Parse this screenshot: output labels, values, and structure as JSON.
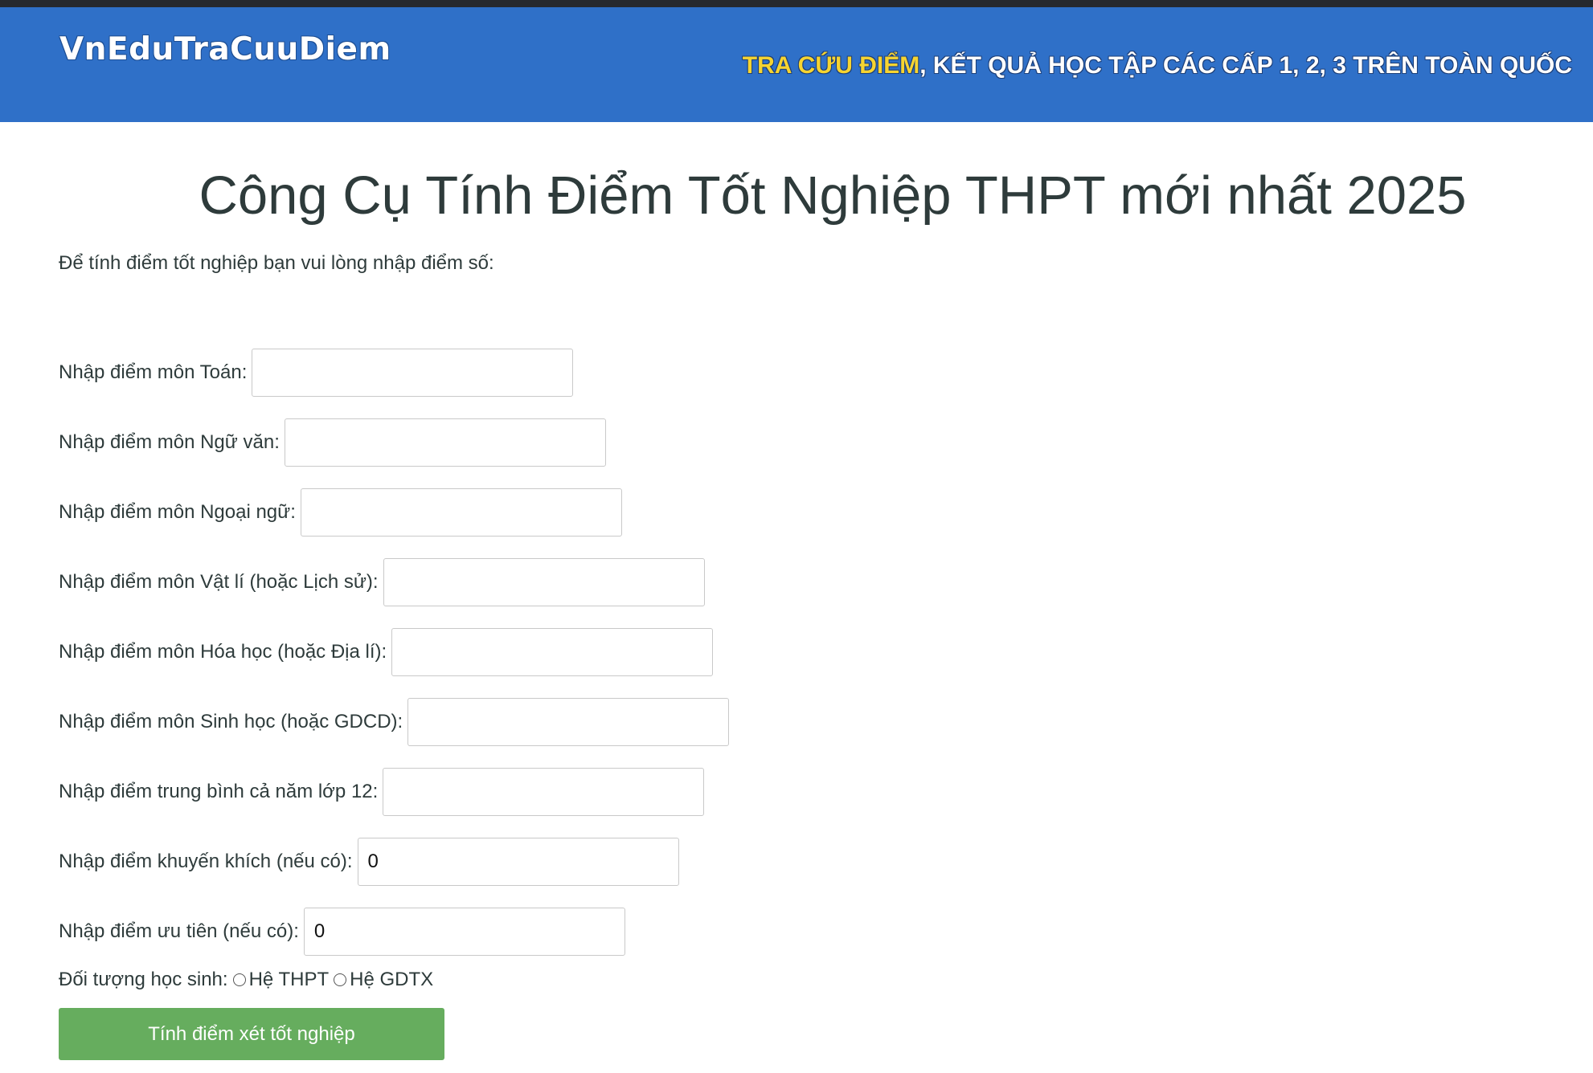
{
  "header": {
    "logo": "VnEduTraCuuDiem",
    "tagline_highlight": "TRA CỨU ĐIỂM",
    "tagline_rest": ", KẾT QUẢ HỌC TẬP CÁC CẤP 1, 2, 3 TRÊN TOÀN QUỐC"
  },
  "main": {
    "title": "Công Cụ Tính Điểm Tốt Nghiệp THPT mới nhất 2025",
    "intro": "Để tính điểm tốt nghiệp bạn vui lòng nhập điểm số:"
  },
  "form": {
    "fields": [
      {
        "label": "Nhập điểm môn Toán:",
        "value": ""
      },
      {
        "label": "Nhập điểm môn Ngữ văn:",
        "value": ""
      },
      {
        "label": "Nhập điểm môn Ngoại ngữ:",
        "value": ""
      },
      {
        "label": "Nhập điểm môn Vật lí (hoặc Lịch sử):",
        "value": ""
      },
      {
        "label": "Nhập điểm môn Hóa học (hoặc Địa lí):",
        "value": ""
      },
      {
        "label": "Nhập điểm môn Sinh học (hoặc GDCD):",
        "value": ""
      },
      {
        "label": "Nhập điểm trung bình cả năm lớp 12:",
        "value": ""
      },
      {
        "label": "Nhập điểm khuyến khích (nếu có):",
        "value": "0"
      },
      {
        "label": "Nhập điểm ưu tiên (nếu có):",
        "value": "0"
      }
    ],
    "student_type_label": "Đối tượng học sinh:",
    "options": [
      "Hệ THPT",
      "Hệ GDTX"
    ],
    "submit_label": "Tính điểm xét tốt nghiệp"
  },
  "colors": {
    "header_bg": "#2f70c8",
    "highlight": "#f6d430",
    "button_bg": "#66ad5e"
  }
}
